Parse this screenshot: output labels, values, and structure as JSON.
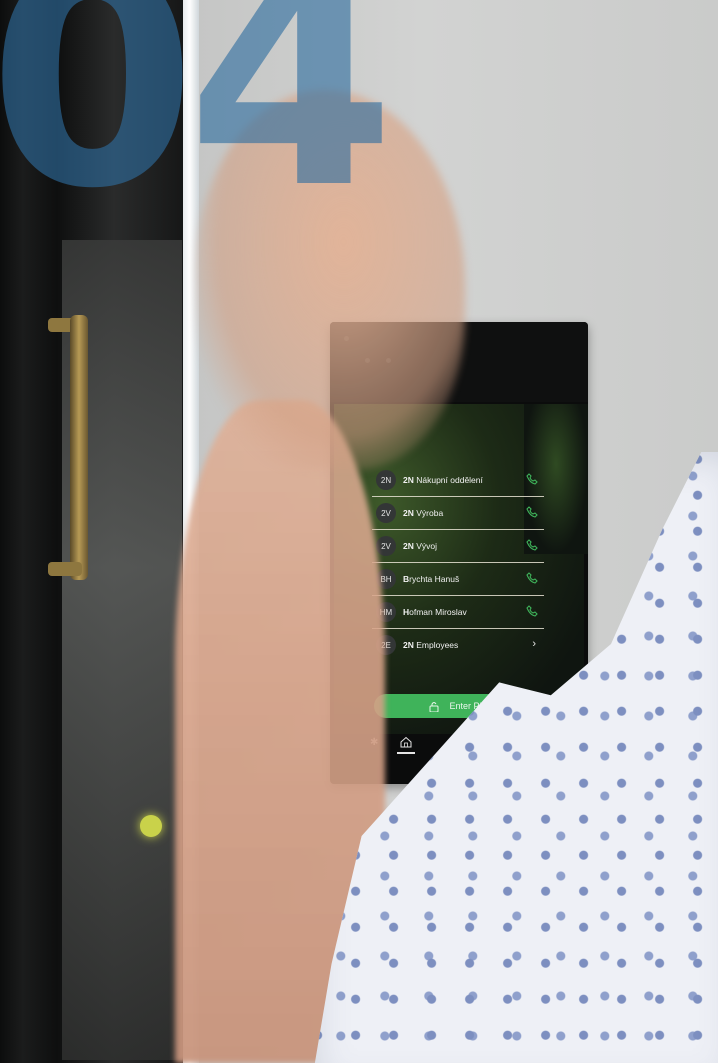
{
  "overlay": {
    "number": "04"
  },
  "intercom": {
    "contacts": [
      {
        "initials": "2N",
        "bold": "2N",
        "rest": " Nákupní oddělení",
        "action": "call"
      },
      {
        "initials": "2V",
        "bold": "2N",
        "rest": " Výroba",
        "action": "call"
      },
      {
        "initials": "2V",
        "bold": "2N",
        "rest": " Vývoj",
        "action": "call"
      },
      {
        "initials": "BH",
        "bold": "B",
        "rest": "rychta Hanuš",
        "action": "call"
      },
      {
        "initials": "HM",
        "bold": "H",
        "rest": "ofman Miroslav",
        "action": "call"
      },
      {
        "initials": "2E",
        "bold": "2N",
        "rest": " Employees",
        "action": "open"
      }
    ],
    "pin_button_label": "Enter PIN",
    "accent_color": "#3fb35a"
  }
}
